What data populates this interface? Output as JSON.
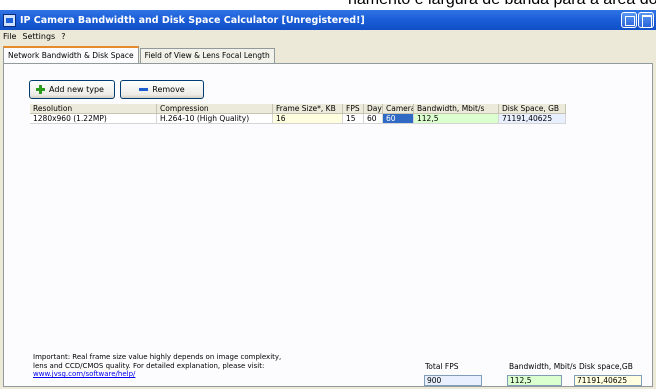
{
  "caption": "namento e largura de banda para a área do porto da c",
  "window": {
    "title": "IP Camera Bandwidth and Disk Space Calculator [Unregistered!]"
  },
  "menu": [
    "File",
    "Settings",
    "?"
  ],
  "tabs": [
    {
      "label": "Network Bandwidth & Disk Space",
      "active": true
    },
    {
      "label": "Field of View & Lens Focal Length",
      "active": false
    }
  ],
  "toolbar": {
    "add_label": "Add new type",
    "remove_label": "Remove"
  },
  "grid": {
    "headers": [
      "Resolution",
      "Compression",
      "Frame Size*, KB",
      "FPS",
      "Days",
      "Cameras",
      "Bandwidth, Mbit/s",
      "Disk Space, GB"
    ],
    "rows": [
      {
        "resolution": "1280x960 (1.22MP)",
        "compression": "H.264-10 (High Quality)",
        "frame_size": "16",
        "fps": "15",
        "days": "60",
        "cameras": "60",
        "bandwidth": "112,5",
        "disk_space": "71191,40625"
      }
    ]
  },
  "note": {
    "text_line1": "Important: Real frame size value highly depends on image complexity,",
    "text_line2": "lens and CCD/CMOS quality. For detailed explanation, please visit:",
    "link": "www.jvsg.com/software/help/"
  },
  "totals": {
    "fps_label": "Total FPS",
    "fps_value": "900",
    "bandwidth_label": "Bandwidth, Mbit/s",
    "bandwidth_value": "112,5",
    "disk_label": "Disk space,GB",
    "disk_value": "71191,40625"
  },
  "colors": {
    "titlebar": "#1c5fd8",
    "selection": "#316ac5",
    "frame_size_cell": "#ffffe0",
    "bandwidth_cell": "#dcffd0"
  }
}
